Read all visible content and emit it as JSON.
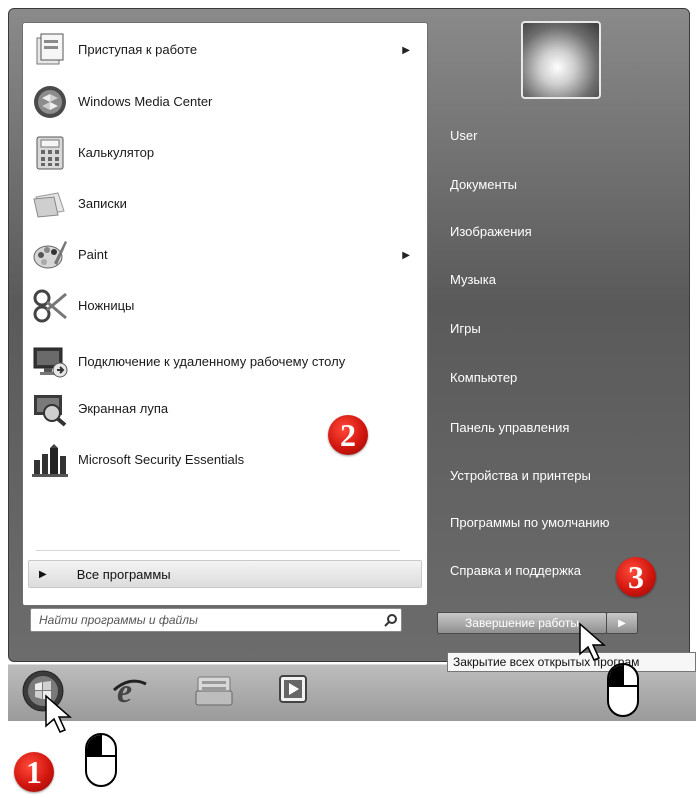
{
  "left_menu": {
    "programs": [
      {
        "label": "Приступая к работе",
        "icon": "getting-started-icon",
        "has_submenu": true
      },
      {
        "label": "Windows Media Center",
        "icon": "media-center-icon",
        "has_submenu": false
      },
      {
        "label": "Калькулятор",
        "icon": "calculator-icon",
        "has_submenu": false
      },
      {
        "label": "Записки",
        "icon": "sticky-notes-icon",
        "has_submenu": false
      },
      {
        "label": "Paint",
        "icon": "paint-icon",
        "has_submenu": true
      },
      {
        "label": "Ножницы",
        "icon": "scissors-icon",
        "has_submenu": false
      },
      {
        "label": "Подключение к удаленному рабочему столу",
        "icon": "remote-desktop-icon",
        "has_submenu": false
      },
      {
        "label": "Экранная лупа",
        "icon": "magnifier-icon",
        "has_submenu": false
      },
      {
        "label": "Microsoft Security Essentials",
        "icon": "security-essentials-icon",
        "has_submenu": false
      }
    ],
    "all_programs": "Все программы",
    "search_placeholder": "Найти программы и файлы"
  },
  "right_menu": {
    "items": [
      "User",
      "Документы",
      "Изображения",
      "Музыка",
      "Игры",
      "Компьютер",
      "Панель управления",
      "Устройства и принтеры",
      "Программы по умолчанию",
      "Справка и поддержка"
    ],
    "shutdown_label": "Завершение работы",
    "tooltip": "Закрытие всех открытых програм"
  },
  "callouts": [
    "1",
    "2",
    "3"
  ],
  "colors": {
    "callout_red": "#d2160f",
    "menu_dark": "#5a5a5a",
    "taskbar": "#a6a6a6"
  }
}
